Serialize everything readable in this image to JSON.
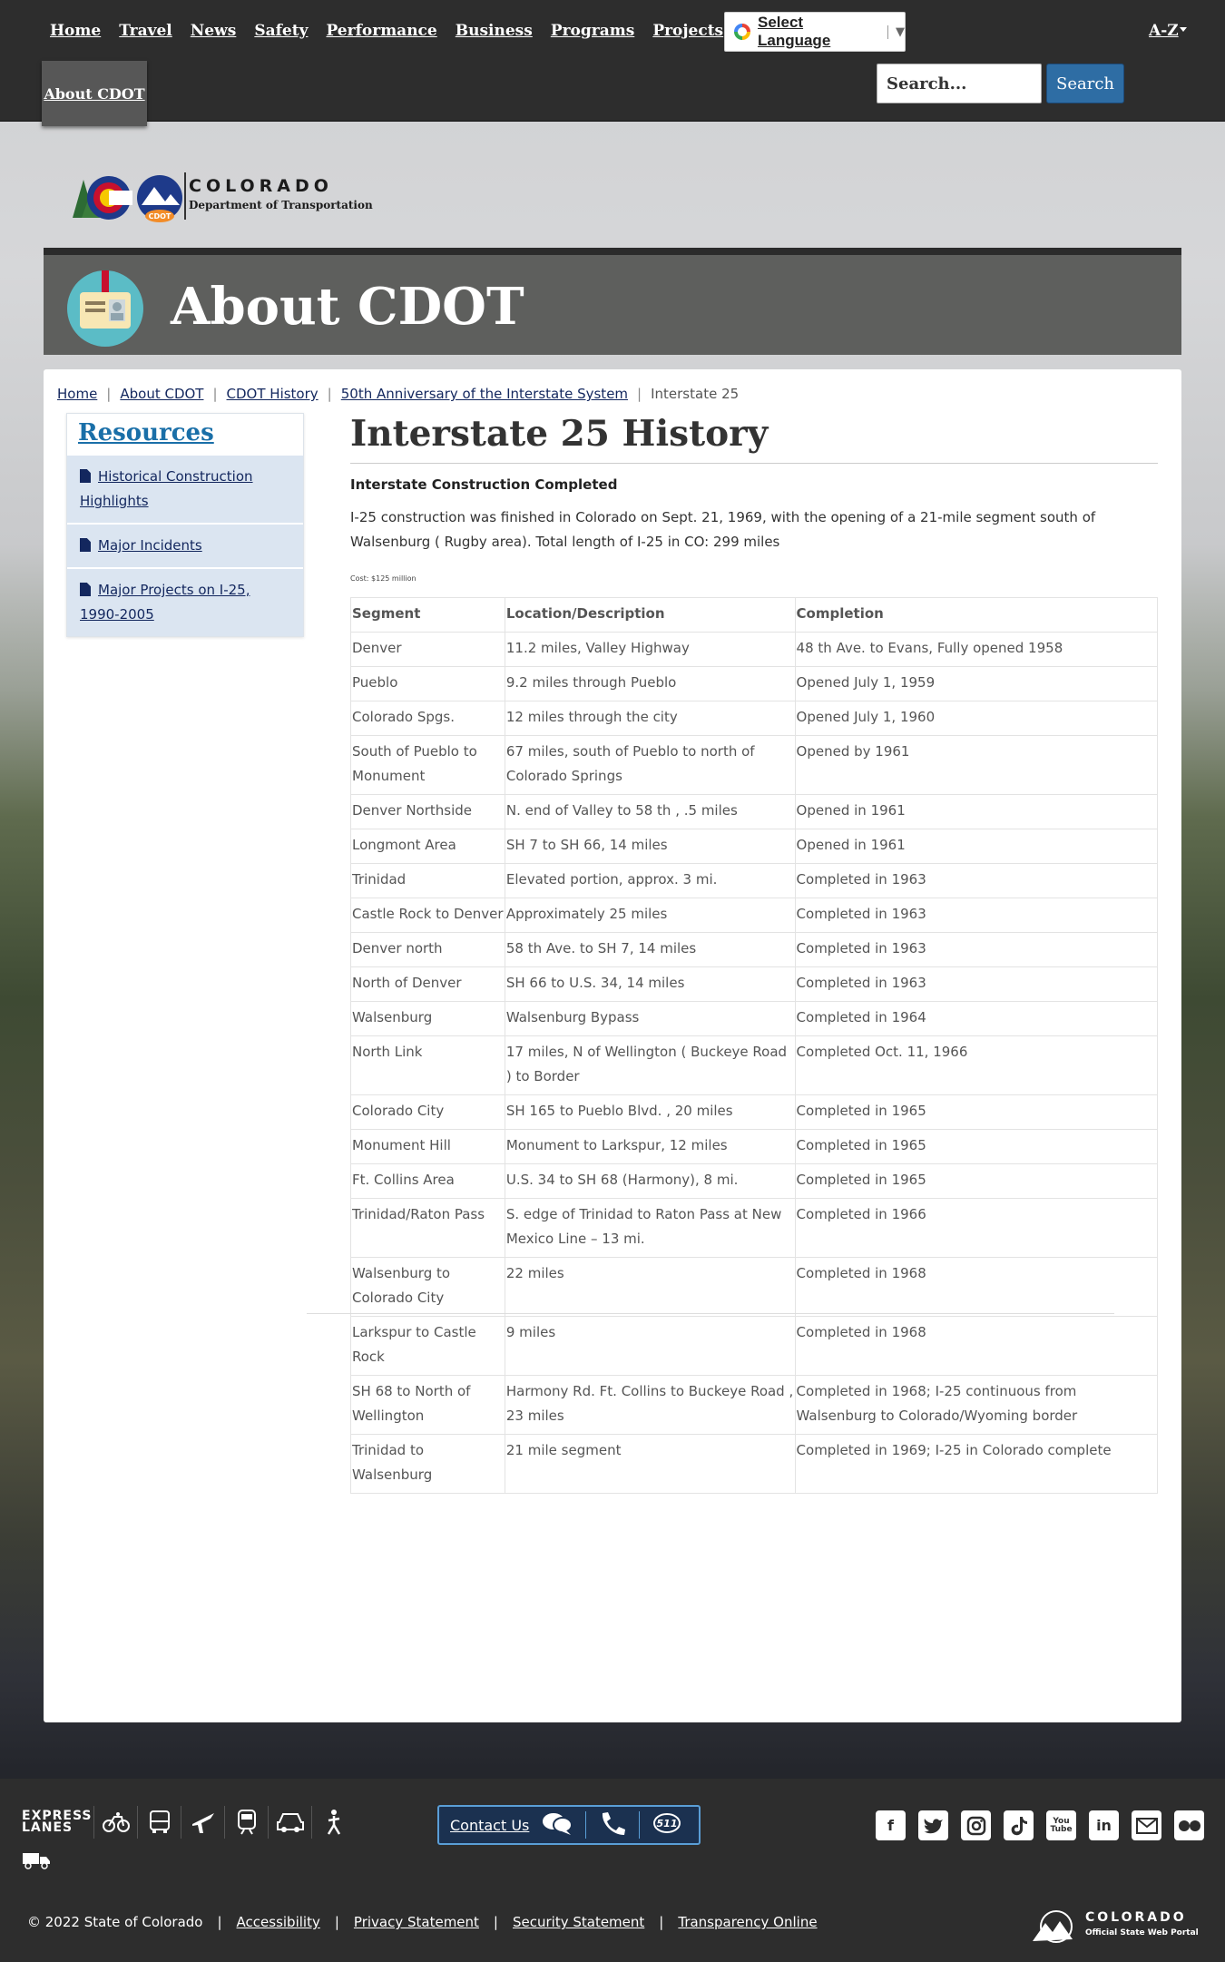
{
  "nav": {
    "links": [
      "Home",
      "Travel",
      "News",
      "Safety",
      "Performance",
      "Business",
      "Programs",
      "Projects"
    ],
    "active_tab": "About CDOT",
    "language_label": "Select Language",
    "az_label": "A-Z",
    "search_placeholder": "Search...",
    "search_button": "Search"
  },
  "logo": {
    "state": "COLORADO",
    "department": "Department of Transportation",
    "badge": "CDOT"
  },
  "banner": {
    "title": "About CDOT"
  },
  "breadcrumb": [
    "Home",
    "About CDOT",
    "CDOT History",
    "50th Anniversary of the Interstate System",
    "Interstate 25"
  ],
  "sidebar": {
    "title": "Resources",
    "items": [
      "Historical Construction Highlights",
      "Major Incidents",
      "Major Projects on I-25, 1990-2005"
    ]
  },
  "content": {
    "title": "Interstate 25 History",
    "subtitle": "Interstate Construction Completed",
    "intro": "I-25 construction was finished in Colorado on Sept. 21, 1969, with the opening of a 21-mile segment south of Walsenburg ( Rugby area). Total length of I-25 in CO: 299 miles",
    "cost": "Cost: $125 million",
    "table": {
      "headers": [
        "Segment",
        "Location/Description",
        "Completion"
      ],
      "rows": [
        [
          "Denver",
          "11.2 miles, Valley Highway",
          "48 th Ave. to Evans, Fully opened 1958"
        ],
        [
          "Pueblo",
          "9.2 miles through Pueblo",
          "Opened July 1, 1959"
        ],
        [
          "Colorado Spgs.",
          "12 miles through the city",
          "Opened July 1, 1960"
        ],
        [
          "South of Pueblo to Monument",
          "67 miles, south of Pueblo to north of Colorado Springs",
          "Opened by 1961"
        ],
        [
          "Denver Northside",
          "N. end of Valley to 58 th , .5 miles",
          "Opened in 1961"
        ],
        [
          "Longmont Area",
          "SH 7 to SH 66, 14 miles",
          "Opened in 1961"
        ],
        [
          "Trinidad",
          "Elevated portion, approx. 3 mi.",
          "Completed in 1963"
        ],
        [
          "Castle Rock to Denver",
          "Approximately 25 miles",
          "Completed in 1963"
        ],
        [
          "Denver north",
          "58 th Ave. to SH 7, 14 miles",
          "Completed in 1963"
        ],
        [
          "North of Denver",
          "SH 66 to U.S. 34, 14 miles",
          "Completed in 1963"
        ],
        [
          "Walsenburg",
          "Walsenburg Bypass",
          "Completed in 1964"
        ],
        [
          "North Link",
          "17 miles, N of Wellington ( Buckeye Road ) to Border",
          "Completed Oct. 11, 1966"
        ],
        [
          "Colorado City",
          "SH 165 to Pueblo Blvd. , 20 miles",
          "Completed in 1965"
        ],
        [
          "Monument Hill",
          "Monument to Larkspur, 12 miles",
          "Completed in 1965"
        ],
        [
          "Ft. Collins Area",
          "U.S. 34 to SH 68 (Harmony), 8 mi.",
          "Completed in 1965"
        ],
        [
          "Trinidad/Raton Pass",
          "S. edge of Trinidad to Raton Pass at New Mexico Line – 13 mi.",
          "Completed in 1966"
        ],
        [
          "Walsenburg to Colorado City",
          "22 miles",
          "Completed in 1968"
        ],
        [
          "Larkspur to Castle Rock",
          "9 miles",
          "Completed in 1968"
        ],
        [
          "SH 68 to North of Wellington",
          "Harmony Rd. Ft. Collins to Buckeye Road , 23 miles",
          "Completed in 1968; I-25 continuous from Walsenburg to Colorado/Wyoming border"
        ],
        [
          "Trinidad to Walsenburg",
          "21 mile segment",
          "Completed in 1969; I-25 in Colorado complete"
        ]
      ]
    }
  },
  "footer": {
    "express_lanes": "EXPRESS LANES",
    "transport_icons": [
      "bicycle-icon",
      "bus-icon",
      "airplane-icon",
      "train-icon",
      "car-icon",
      "pedestrian-icon"
    ],
    "contact_label": "Contact Us",
    "contact_badge": "511",
    "social_icons": [
      "facebook-icon",
      "twitter-icon",
      "instagram-icon",
      "tiktok-icon",
      "youtube-icon",
      "linkedin-icon",
      "email-icon",
      "flickr-icon"
    ],
    "copyright": "© 2022 State of Colorado",
    "legal_links": [
      "Accessibility",
      "Privacy Statement",
      "Security Statement",
      "Transparency Online"
    ],
    "state_logo": {
      "name": "COLORADO",
      "tagline": "Official State Web Portal"
    }
  }
}
